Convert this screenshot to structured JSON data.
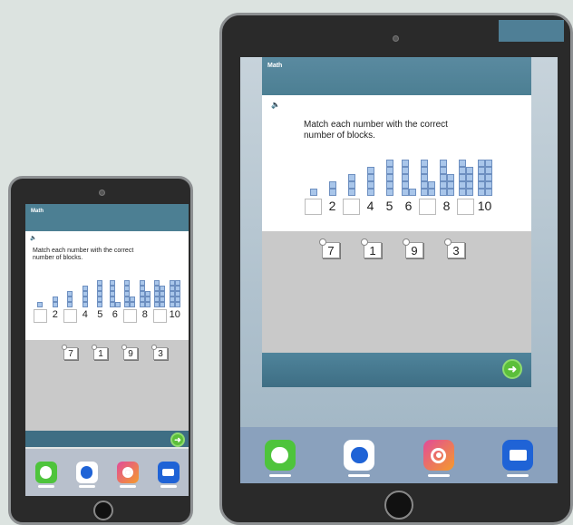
{
  "app": {
    "subject": "Math",
    "prompt_line1": "Match each number with the correct",
    "prompt_line2": "number of blocks.",
    "speaker_icon": "speaker-icon",
    "next_icon": "arrow-right-icon",
    "accent_header": "#4c7f93",
    "accent_next": "#5bbf3a"
  },
  "block_columns": [
    {
      "count": 1,
      "label": ""
    },
    {
      "count": 2,
      "label": "2"
    },
    {
      "count": 3,
      "label": ""
    },
    {
      "count": 4,
      "label": "4"
    },
    {
      "count": 5,
      "label": "5"
    },
    {
      "count": 6,
      "label": "6"
    },
    {
      "count": 7,
      "label": ""
    },
    {
      "count": 8,
      "label": "8"
    },
    {
      "count": 9,
      "label": ""
    },
    {
      "count": 10,
      "label": "10"
    }
  ],
  "answer_tiles": [
    "7",
    "1",
    "9",
    "3"
  ],
  "dock": [
    {
      "icon": "messages-icon",
      "color": "#4ec43c"
    },
    {
      "icon": "camera-icon",
      "color": "#1f63d6"
    },
    {
      "icon": "photos-icon",
      "color": "#e14b9a"
    },
    {
      "icon": "browser-icon",
      "color": "#1f63d6"
    }
  ]
}
